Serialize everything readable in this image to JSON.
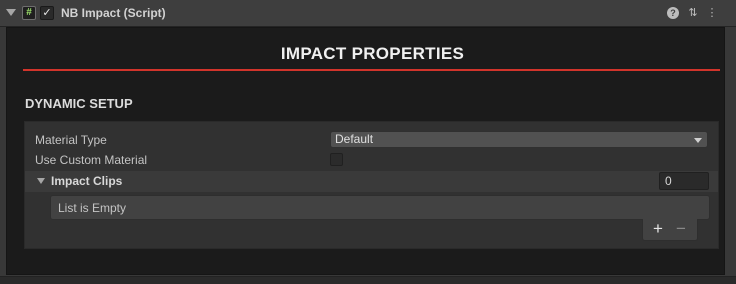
{
  "component": {
    "title": "NB Impact (Script)",
    "script_icon": "#",
    "enabled_check": "✓",
    "help_glyph": "?",
    "presets_glyph": "⇅",
    "menu_glyph": "⋮"
  },
  "main": {
    "section_title": "IMPACT PROPERTIES",
    "subsection_title": "DYNAMIC SETUP",
    "accent_color": "#d2342b"
  },
  "fields": {
    "material_type_label": "Material Type",
    "material_type_value": "Default",
    "use_custom_material_label": "Use Custom Material",
    "use_custom_material_checked": false
  },
  "impact_clips": {
    "label": "Impact Clips",
    "count": "0",
    "empty_text": "List is Empty",
    "add_glyph": "+",
    "remove_glyph": "−"
  }
}
